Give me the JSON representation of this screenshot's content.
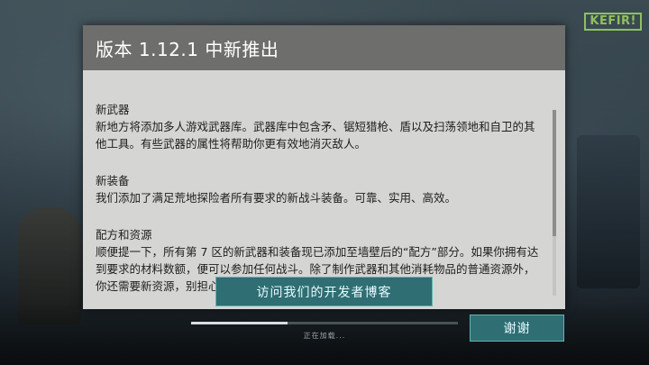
{
  "logo": {
    "text": "KEFIR!"
  },
  "dialog": {
    "title": "版本 1.12.1 中新推出",
    "sections": [
      {
        "title": "新武器",
        "text": "新地方将添加多人游戏武器库。武器库中包含矛、锯短猎枪、盾以及扫荡领地和自卫的其他工具。有些武器的属性将帮助你更有效地消灭敌人。"
      },
      {
        "title": "新装备",
        "text": "我们添加了满足荒地探险者所有要求的新战斗装备。可靠、实用、高效。"
      },
      {
        "title": "配方和资源",
        "text": "顺便提一下，所有第 7 区的新武器和装备现已添加至墙壁后的“配方”部分。如果你拥有达到要求的材料数额，便可以参加任何战斗。除了制作武器和其他消耗物品的普通资源外，你还需要新资源，别担心，游戏中已提供新资源。"
      }
    ],
    "blog_button_label": "访问我们的开发者博客"
  },
  "loading": {
    "label": "正在加载...",
    "progress": 0.36
  },
  "thanks_button_label": "谢谢",
  "colors": {
    "dialog_header": "#6e6e6c",
    "dialog_body": "#d5d5d3",
    "button_fill": "#2f6e72",
    "button_border": "#5fb5b4",
    "logo_green": "#8fbf5f"
  }
}
